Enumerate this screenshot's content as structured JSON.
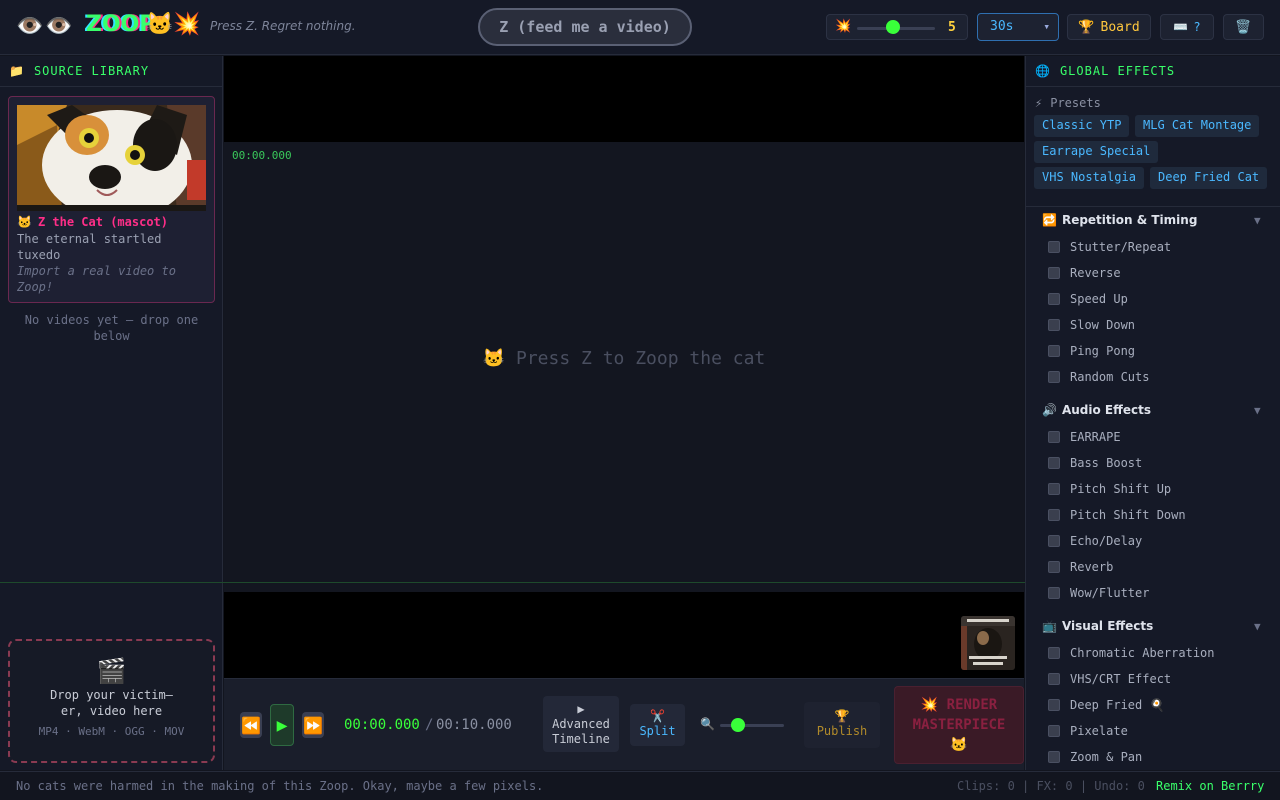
{
  "header": {
    "logo_eyes": "👁️👁️",
    "logo_text": "ZOOP",
    "logo_cat": "🐱💥",
    "tagline": "Press Z. Regret nothing.",
    "feed_button": "Z (feed me a video)",
    "chaos_icon": "💥",
    "chaos_value": "5",
    "duration_value": "30s",
    "board_icon": "🏆",
    "board_label": "Board",
    "keyboard_icon": "⌨️",
    "help_label": "?",
    "trash_icon": "🗑️"
  },
  "source_library": {
    "icon": "📁",
    "title": "SOURCE LIBRARY",
    "card": {
      "icon": "🐱",
      "title": "Z the Cat (mascot)",
      "description": "The eternal startled tuxedo",
      "hint": "Import a real video to Zoop!"
    },
    "empty_note": "No videos yet — drop one below",
    "drop_zone": {
      "icon": "🎬",
      "label": "Drop your victim— er, video here",
      "formats": "MP4 · WebM · OGG · MOV"
    }
  },
  "viewer": {
    "timecode": "00:00.000",
    "placeholder_icon": "🐱",
    "placeholder": "Press Z to Zoop the cat"
  },
  "transport": {
    "rewind_icon": "⏪",
    "play_icon": "▶",
    "forward_icon": "⏩",
    "current_time": "00:00.000",
    "separator": "/",
    "total_time": "00:10.000",
    "advanced_icon": "▶",
    "advanced_label": "Advanced Timeline",
    "split_icon": "✂️",
    "split_label": "Split",
    "zoom_icon": "🔍",
    "publish_icon": "🏆",
    "publish_label": "Publish",
    "render_icon": "💥",
    "render_label": "RENDER MASTERPIECE",
    "render_tail_icon": "🐱"
  },
  "global_effects": {
    "icon": "🌐",
    "title": "GLOBAL EFFECTS",
    "presets_icon": "⚡",
    "presets_label": "Presets",
    "presets": [
      "Classic YTP",
      "MLG Cat Montage",
      "Earrape Special",
      "VHS Nostalgia",
      "Deep Fried Cat"
    ],
    "groups": [
      {
        "icon": "🔁",
        "title": "Repetition & Timing",
        "items": [
          "Stutter/Repeat",
          "Reverse",
          "Speed Up",
          "Slow Down",
          "Ping Pong",
          "Random Cuts"
        ]
      },
      {
        "icon": "🔊",
        "title": "Audio Effects",
        "items": [
          "EARRAPE",
          "Bass Boost",
          "Pitch Shift Up",
          "Pitch Shift Down",
          "Echo/Delay",
          "Reverb",
          "Wow/Flutter"
        ]
      },
      {
        "icon": "📺",
        "title": "Visual Effects",
        "items": [
          "Chromatic Aberration",
          "VHS/CRT Effect",
          "Deep Fried 🍳",
          "Pixelate",
          "Zoom & Pan"
        ]
      }
    ]
  },
  "footer": {
    "message": "No cats were harmed in the making of this Zoop. Okay, maybe a few pixels.",
    "stats": "Clips: 0 | FX: 0 | Undo: 0",
    "remix": "Remix on Berrry"
  },
  "colors": {
    "accent_green": "#39ff6a",
    "accent_pink": "#ff2e88",
    "accent_blue": "#4ab8ff",
    "accent_yellow": "#ffd23e"
  }
}
